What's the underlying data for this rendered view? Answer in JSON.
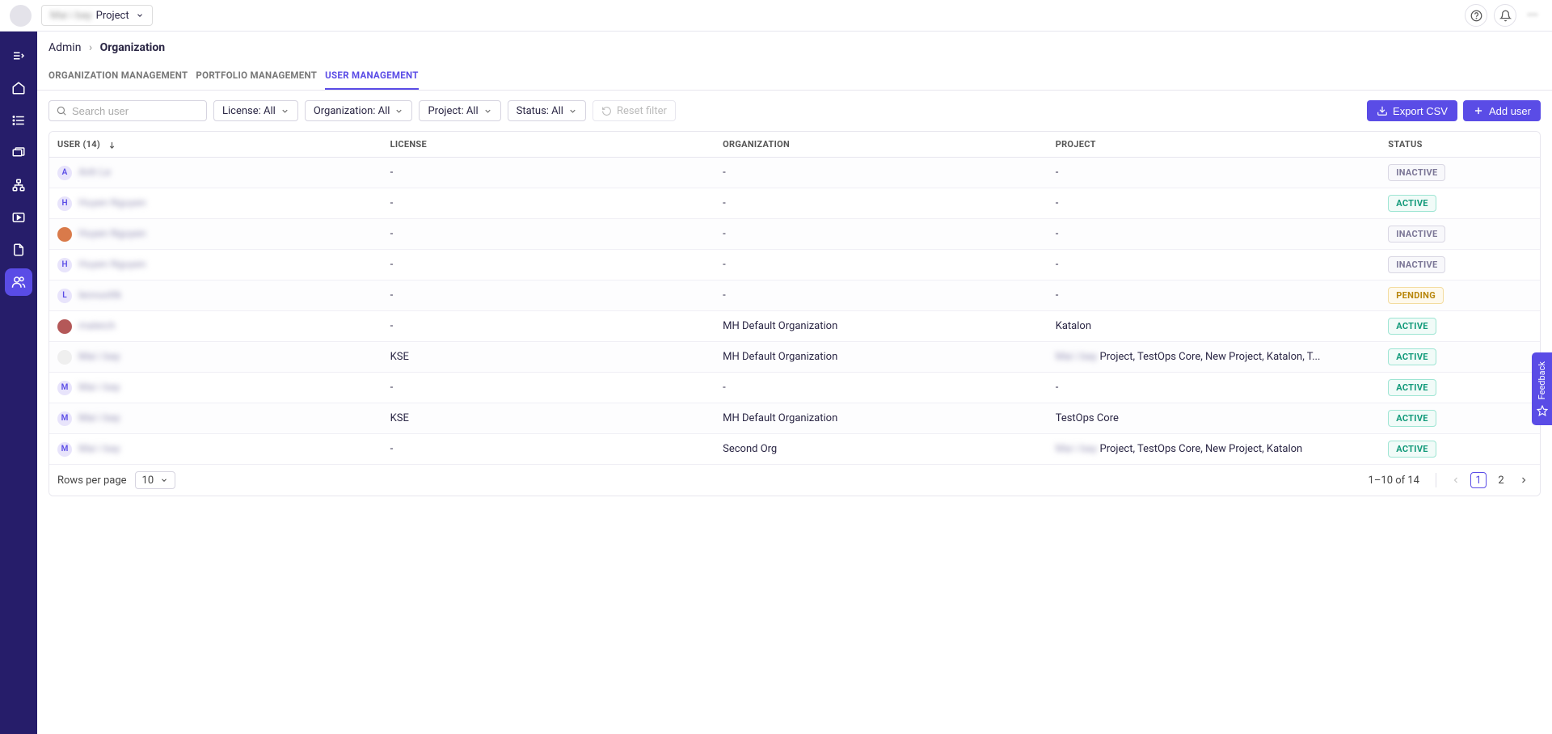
{
  "header": {
    "project_prefix": "Mai i bay",
    "project_label": "Project"
  },
  "breadcrumb": {
    "parent": "Admin",
    "current": "Organization"
  },
  "tabs": [
    {
      "label": "ORGANIZATION MANAGEMENT",
      "active": false
    },
    {
      "label": "PORTFOLIO MANAGEMENT",
      "active": false
    },
    {
      "label": "USER MANAGEMENT",
      "active": true
    }
  ],
  "toolbar": {
    "search_placeholder": "Search user",
    "filters": {
      "license": "License: All",
      "organization": "Organization: All",
      "project": "Project: All",
      "status": "Status: All"
    },
    "reset_label": "Reset filter",
    "export_label": "Export CSV",
    "add_user_label": "Add user"
  },
  "table": {
    "columns": {
      "user": "USER (14)",
      "license": "LICENSE",
      "organization": "ORGANIZATION",
      "project": "PROJECT",
      "status": "STATUS"
    },
    "rows": [
      {
        "avatar_text": "A",
        "avatar_bg": "#cfc8f8",
        "avatar_img": false,
        "name": "Anh Le",
        "license": "-",
        "organization": "-",
        "project_prefix": "",
        "project": "-",
        "status": "INACTIVE",
        "status_kind": "inactive"
      },
      {
        "avatar_text": "H",
        "avatar_bg": "#cfc8f8",
        "avatar_img": false,
        "name": "Huyen Nguyen",
        "license": "-",
        "organization": "-",
        "project_prefix": "",
        "project": "-",
        "status": "ACTIVE",
        "status_kind": "active"
      },
      {
        "avatar_text": "",
        "avatar_bg": "#d97a4a",
        "avatar_img": true,
        "name": "Huyen Nguyen",
        "license": "-",
        "organization": "-",
        "project_prefix": "",
        "project": "-",
        "status": "INACTIVE",
        "status_kind": "inactive"
      },
      {
        "avatar_text": "H",
        "avatar_bg": "#cfc8f8",
        "avatar_img": false,
        "name": "Huyen Nguyen",
        "license": "-",
        "organization": "-",
        "project_prefix": "",
        "project": "-",
        "status": "INACTIVE",
        "status_kind": "inactive"
      },
      {
        "avatar_text": "L",
        "avatar_bg": "#cfc8f8",
        "avatar_img": false,
        "name": "leovuottk",
        "license": "-",
        "organization": "-",
        "project_prefix": "",
        "project": "-",
        "status": "PENDING",
        "status_kind": "pending"
      },
      {
        "avatar_text": "",
        "avatar_bg": "#b45858",
        "avatar_img": true,
        "name": "maleich",
        "license": "-",
        "organization": "MH Default Organization",
        "project_prefix": "",
        "project": "Katalon",
        "status": "ACTIVE",
        "status_kind": "active"
      },
      {
        "avatar_text": "",
        "avatar_bg": "#efefef",
        "avatar_img": true,
        "name": "Mai i bay",
        "license": "KSE",
        "organization": "MH Default Organization",
        "project_prefix": "Mai i bay",
        "project": " Project, TestOps Core, New Project, Katalon, T...",
        "status": "ACTIVE",
        "status_kind": "active"
      },
      {
        "avatar_text": "M",
        "avatar_bg": "#cfc8f8",
        "avatar_img": false,
        "name": "Mai i bay",
        "license": "-",
        "organization": "-",
        "project_prefix": "",
        "project": "-",
        "status": "ACTIVE",
        "status_kind": "active"
      },
      {
        "avatar_text": "M",
        "avatar_bg": "#cfc8f8",
        "avatar_img": false,
        "name": "Mai i bay",
        "license": "KSE",
        "organization": "MH Default Organization",
        "project_prefix": "",
        "project": "TestOps Core",
        "status": "ACTIVE",
        "status_kind": "active"
      },
      {
        "avatar_text": "M",
        "avatar_bg": "#cfc8f8",
        "avatar_img": false,
        "name": "Mai i bay",
        "license": "-",
        "organization": "Second Org",
        "project_prefix": "Mai i bay",
        "project": " Project, TestOps Core, New Project, Katalon",
        "status": "ACTIVE",
        "status_kind": "active"
      }
    ]
  },
  "footer": {
    "rows_label": "Rows per page",
    "rows_value": "10",
    "range_label": "1–10 of 14",
    "pages": [
      "1",
      "2"
    ],
    "current_page": "1"
  },
  "feedback_label": "Feedback",
  "top_right_dots": "•••"
}
